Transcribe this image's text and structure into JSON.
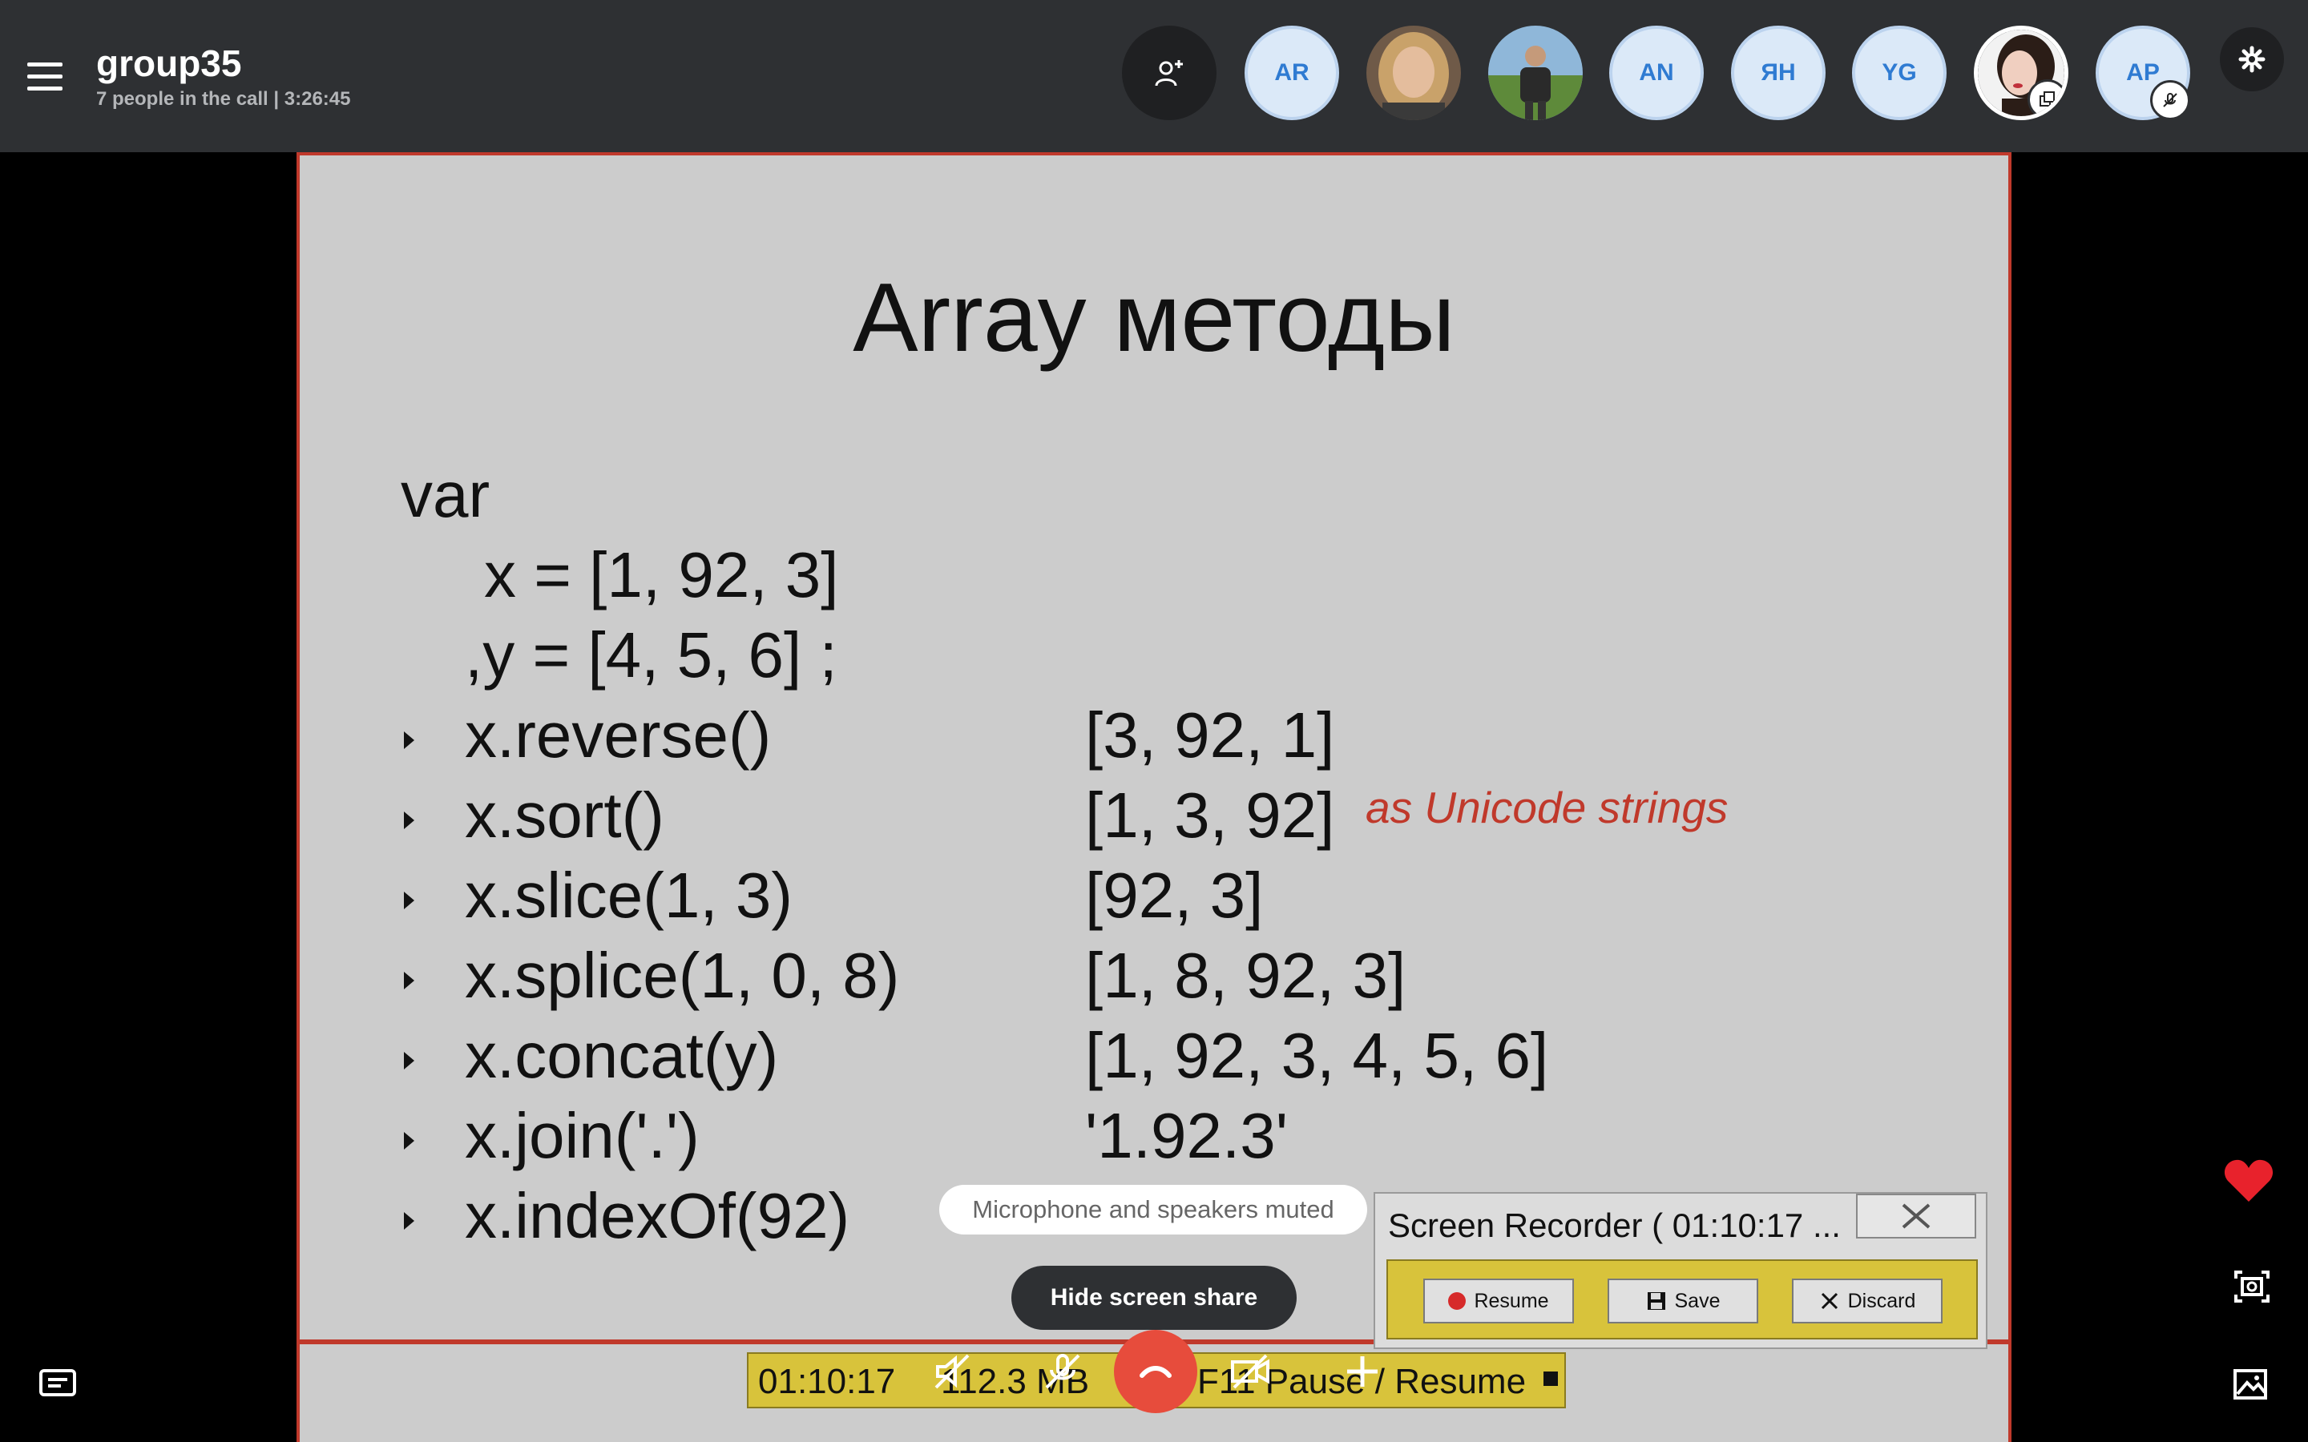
{
  "header": {
    "title": "group35",
    "subtitle": "7 people in the call | 3:26:45"
  },
  "participants": [
    {
      "initials": "AR"
    },
    {
      "initials": ""
    },
    {
      "initials": ""
    },
    {
      "initials": "AN"
    },
    {
      "initials": "ЯН"
    },
    {
      "initials": "YG"
    },
    {
      "initials": ""
    },
    {
      "initials": "AP"
    }
  ],
  "slide": {
    "title": "Array методы",
    "lines": {
      "var": "var",
      "x_decl": "x = [1, 92, 3]",
      "y_decl": ",y = [4, 5, 6] ;",
      "m1": "x.reverse()",
      "r1": "[3, 92, 1]",
      "m2": "x.sort()",
      "r2": "[1, 3, 92]",
      "m3": "x.slice(1, 3)",
      "r3": "[92, 3]",
      "m4": "x.splice(1, 0, 8)",
      "r4": "[1, 8, 92, 3]",
      "m5": "x.concat(y)",
      "r5": "[1, 92, 3, 4, 5, 6]",
      "m6": "x.join('.')",
      "r6": "'1.92.3'",
      "m7": "x.indexOf(92)"
    },
    "note": "as Unicode strings"
  },
  "recording_bar": {
    "time": "01:10:17",
    "size": "112.3 MB",
    "hint": "F11 Pause / Resume"
  },
  "toast": "Microphone and speakers muted",
  "hide_share_label": "Hide screen share",
  "recorder": {
    "title": "Screen Recorder ( 01:10:17  ...",
    "resume": "Resume",
    "save": "Save",
    "discard": "Discard"
  },
  "colors": {
    "accent_red": "#c0392b",
    "recorder_yellow": "#d8c33b",
    "avatar_blue": "#2f7bd2",
    "hangup_red": "#e74c3c"
  }
}
